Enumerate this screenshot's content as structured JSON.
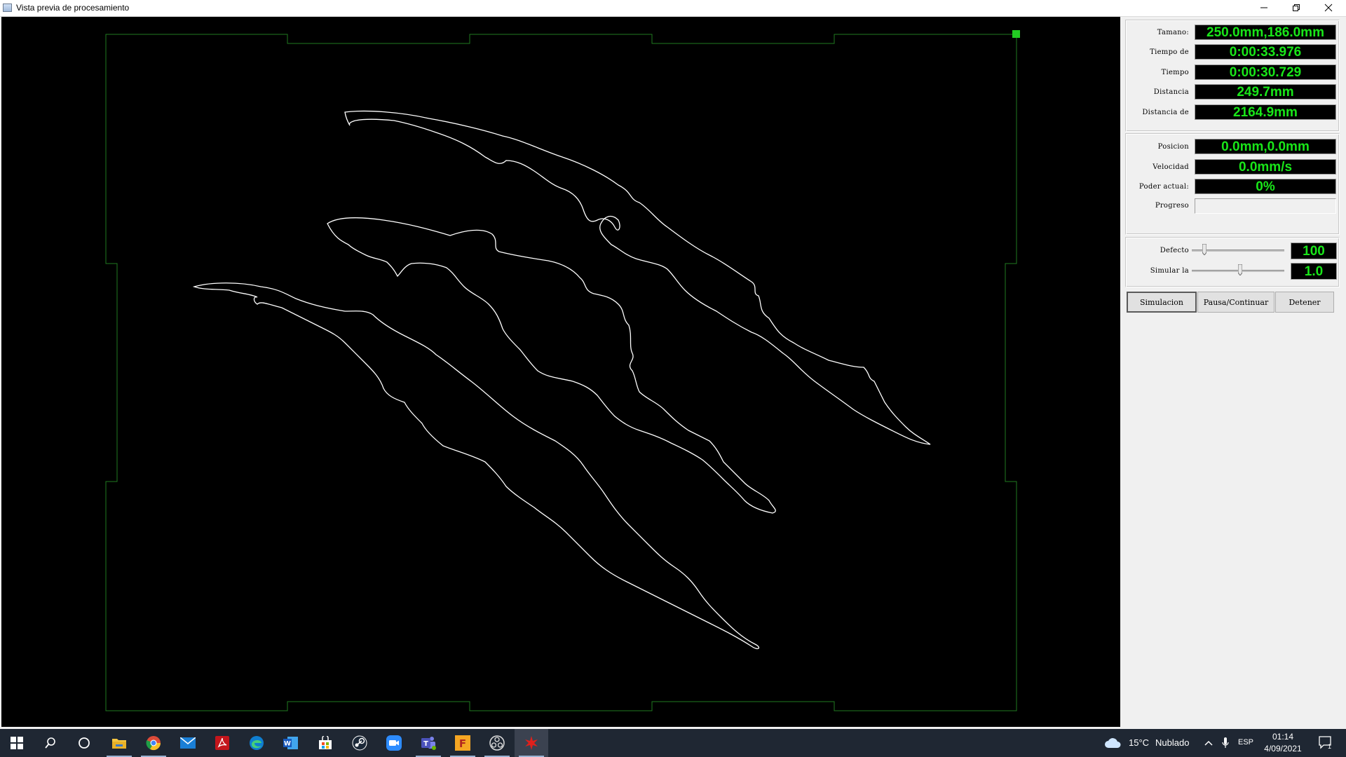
{
  "window": {
    "title": "Vista previa de procesamiento"
  },
  "info": {
    "rows": [
      {
        "label": "Tamano:",
        "value": "250.0mm,186.0mm"
      },
      {
        "label": "Tiempo de",
        "value": "0:00:33.976"
      },
      {
        "label": "Tiempo",
        "value": "0:00:30.729"
      },
      {
        "label": "Distancia",
        "value": "249.7mm"
      },
      {
        "label": "Distancia de",
        "value": "2164.9mm"
      }
    ]
  },
  "status": {
    "position_label": "Posicion",
    "position_value": "0.0mm,0.0mm",
    "speed_label": "Velocidad",
    "speed_value": "0.0mm/s",
    "power_label": "Poder actual:",
    "power_value": "0%",
    "progress_label": "Progreso",
    "progress_fraction": 0
  },
  "controls": {
    "default_label": "Defecto",
    "default_value": "100",
    "default_slider_fraction": 0.12,
    "simulate_label": "Simular la",
    "simulate_value": "1.0",
    "simulate_slider_fraction": 0.52
  },
  "buttons": {
    "simulate": "Simulacion",
    "pause": "Pausa/Continuar",
    "stop": "Detener"
  },
  "colors": {
    "readout_text": "#19e619",
    "readout_bg": "#000000",
    "canvas_bg": "#000000",
    "work_border": "#1f7a1f",
    "origin_marker": "#22cc22",
    "path": "#ffffff"
  },
  "taskbar": {
    "icons": [
      "windows-start-icon",
      "search-icon",
      "cortana-icon",
      "file-explorer-icon",
      "chrome-icon",
      "mail-icon",
      "acrobat-icon",
      "edge-icon",
      "word-icon",
      "store-icon",
      "steam-icon",
      "zoom-icon",
      "teams-icon",
      "fusion-icon",
      "obs-icon",
      "laser-app-icon"
    ],
    "weather_temp": "15°C",
    "weather_desc": "Nublado",
    "language": "ESP",
    "time": "01:14",
    "date": "4/09/2021",
    "notification_count": "1"
  }
}
